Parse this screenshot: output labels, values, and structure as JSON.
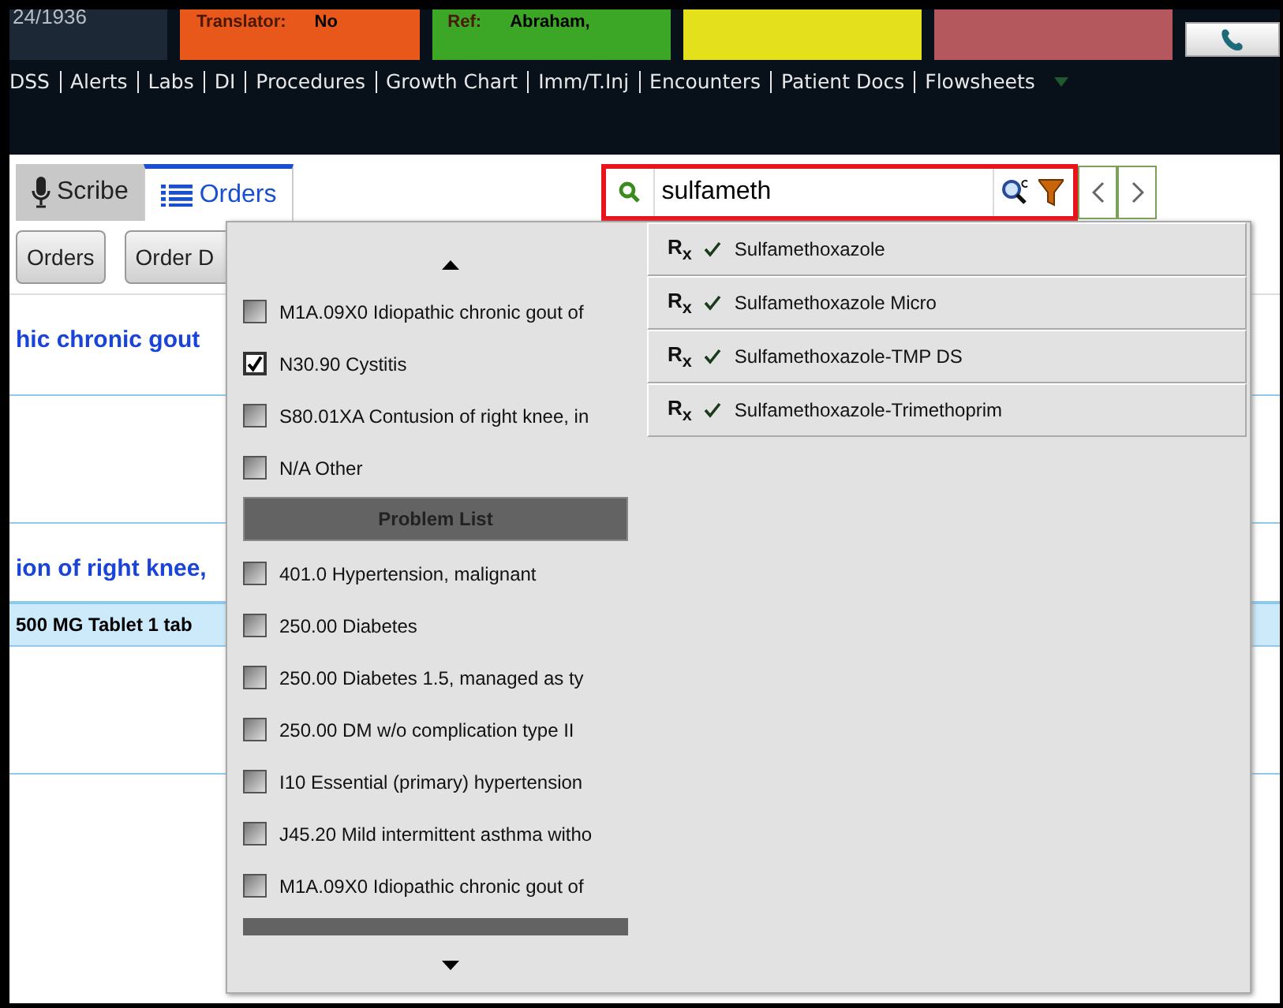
{
  "header": {
    "tiles": [
      {
        "kind": "date",
        "text": "24/1936"
      },
      {
        "kind": "labeled",
        "label": "Translator:",
        "value": "No",
        "color": "#e8581a"
      },
      {
        "kind": "labeled",
        "label": "Ref:",
        "value": "Abraham,",
        "color": "#3ca626"
      },
      {
        "kind": "art",
        "color": "#e4e01c"
      },
      {
        "kind": "art",
        "color": "#b4585e"
      },
      {
        "kind": "phone"
      }
    ]
  },
  "nav_links": [
    "DSS",
    "Alerts",
    "Labs",
    "DI",
    "Procedures",
    "Growth Chart",
    "Imm/T.Inj",
    "Encounters",
    "Patient Docs",
    "Flowsheets"
  ],
  "tabs": [
    {
      "label": "Scribe",
      "kind": "mic",
      "selected": false
    },
    {
      "label": "Orders",
      "kind": "list",
      "selected": true
    }
  ],
  "search": {
    "value": "sulfameth"
  },
  "toolbar_buttons": [
    "Orders",
    "Order D"
  ],
  "content": [
    {
      "kind": "title",
      "text": "hic chronic gout"
    },
    {
      "kind": "gap"
    },
    {
      "kind": "title",
      "text": "ion of right knee,"
    },
    {
      "kind": "row",
      "text": "500 MG Tablet 1 tab"
    },
    {
      "kind": "gap"
    }
  ],
  "diagnosis_list": [
    {
      "kind": "item",
      "label": "M1A.09X0 Idiopathic chronic gout of",
      "checked": false
    },
    {
      "kind": "item",
      "label": "N30.90 Cystitis",
      "checked": true
    },
    {
      "kind": "item",
      "label": "S80.01XA Contusion of right knee, in",
      "checked": false
    },
    {
      "kind": "item",
      "label": "N/A Other",
      "checked": false
    },
    {
      "kind": "header",
      "label": "Problem List"
    },
    {
      "kind": "item",
      "label": "401.0 Hypertension, malignant",
      "checked": false
    },
    {
      "kind": "item",
      "label": "250.00 Diabetes",
      "checked": false
    },
    {
      "kind": "item",
      "label": "250.00 Diabetes 1.5, managed as ty",
      "checked": false
    },
    {
      "kind": "item",
      "label": "250.00 DM w/o complication type II",
      "checked": false
    },
    {
      "kind": "item",
      "label": "I10 Essential (primary) hypertension",
      "checked": false
    },
    {
      "kind": "item",
      "label": "J45.20 Mild intermittent asthma witho",
      "checked": false
    },
    {
      "kind": "item",
      "label": "M1A.09X0 Idiopathic chronic gout of",
      "checked": false
    }
  ],
  "search_results": [
    {
      "symbol": "R$_{x}$",
      "label": "Sulfamethoxazole"
    },
    {
      "symbol": "R$_{x}$",
      "label": "Sulfamethoxazole Micro"
    },
    {
      "symbol": "R$_{x}$",
      "label": "Sulfamethoxazole-TMP DS"
    },
    {
      "symbol": "R$_{x}$",
      "label": "Sulfamethoxazole-Trimethoprim"
    }
  ]
}
